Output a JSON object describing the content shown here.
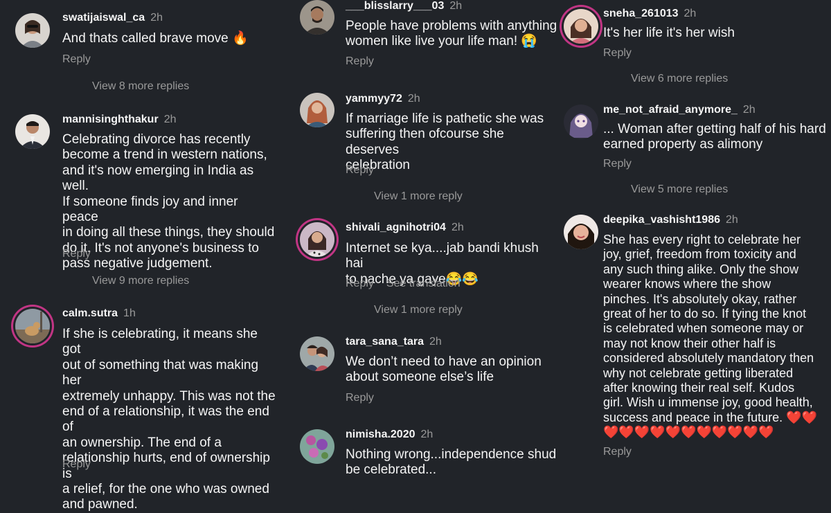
{
  "accent": "#c13584",
  "reply_label": "Reply",
  "columns": [
    {
      "comments": [
        {
          "username": "swatijaiswal_ca",
          "time": "2h",
          "text": "And thats called brave move 🔥",
          "more": "View 8 more replies",
          "avatar_icon": "woman-sunglasses-avatar"
        },
        {
          "username": "mannisinghthakur",
          "time": "2h",
          "text": "Celebrating divorce has recently\nbecome a trend in western nations,\nand it's now emerging in India as well.\nIf someone finds joy and inner peace\nin doing all these things, they should\ndo it. It's not anyone's business to\npass negative judgement.",
          "more": "View 9 more replies",
          "avatar_icon": "man-suit-avatar"
        },
        {
          "username": "calm.sutra",
          "time": "1h",
          "text": "If she is celebrating, it means she got\nout of something that was making her\nextremely unhappy. This was not the\nend of a relationship, it was the end of\nan ownership. The end of a\nrelationship hurts, end of ownership is\na relief, for the one who was owned\nand pawned.",
          "more": "",
          "avatar_icon": "dog-outdoor-avatar"
        }
      ]
    },
    {
      "comments": [
        {
          "username": "___blisslarry___03",
          "time": "2h",
          "text": "People have problems with anything\nwomen like live your life man! 😭",
          "more": "",
          "avatar_icon": "man-portrait-avatar"
        },
        {
          "username": "yammyy72",
          "time": "2h",
          "text": "If marriage life is pathetic she was\nsuffering then ofcourse she deserves\ncelebration",
          "more": "View 1 more reply",
          "avatar_icon": "woman-portrait-avatar"
        },
        {
          "username": "shivali_agnihotri04",
          "time": "2h",
          "text": "Internet se kya....jab bandi khush hai\nto nache ya gaye😂😂",
          "more": "View 1 more reply",
          "see_translation": "See translation",
          "avatar_icon": "woman-selfie-avatar"
        },
        {
          "username": "tara_sana_tara",
          "time": "2h",
          "text": "We don’t need to have an opinion\nabout someone else’s life",
          "more": "",
          "avatar_icon": "couple-avatar"
        },
        {
          "username": "nimisha.2020",
          "time": "2h",
          "text": "Nothing wrong...independence shud\nbe celebrated...",
          "more": "",
          "avatar_icon": "flowers-avatar"
        }
      ]
    },
    {
      "comments": [
        {
          "username": "sneha_261013",
          "time": "2h",
          "text": "It's her life it's her wish",
          "more": "View 6 more replies",
          "avatar_icon": "woman-smile-avatar"
        },
        {
          "username": "me_not_afraid_anymore_",
          "time": "2h",
          "text": "... Woman after getting half of his hard\nearned property as alimony",
          "more": "View 5 more replies",
          "avatar_icon": "anime-girl-avatar"
        },
        {
          "username": "deepika_vashisht1986",
          "time": "2h",
          "text": "She has every right to celebrate her\njoy, grief, freedom from toxicity and\nany such thing alike. Only the show\nwearer knows where the show\npinches. It's absolutely okay, rather\ngreat of her to do so. If tying the knot\nis celebrated when someone may or\nmay not know their other half is\nconsidered absolutely mandatory then\nwhy not celebrate getting liberated\nafter knowing their real self. Kudos\ngirl. Wish u immense joy, good health,\nsuccess and peace in the future. ❤️❤️\n❤️❤️❤️❤️❤️❤️❤️❤️❤️❤️❤️",
          "more": "",
          "avatar_icon": "woman-closeup-avatar"
        }
      ]
    }
  ]
}
